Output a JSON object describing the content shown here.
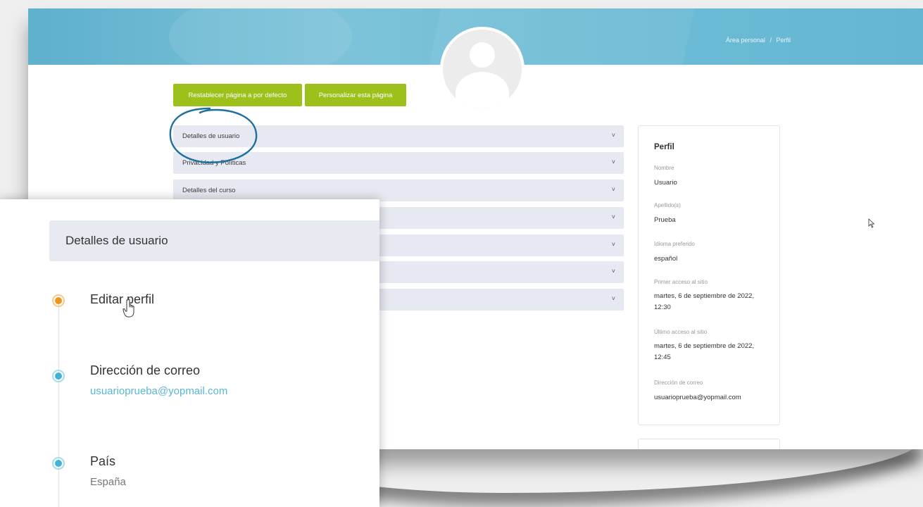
{
  "breadcrumb": {
    "item1": "Área personal",
    "separator": "/",
    "item2": "Perfil"
  },
  "buttons": {
    "reset": "Restablecer página a por defecto",
    "customize": "Personalizar esta página"
  },
  "accordion": [
    {
      "label": "Detalles de usuario"
    },
    {
      "label": "Privacidad y Políticas"
    },
    {
      "label": "Detalles del curso"
    },
    {
      "label": ""
    },
    {
      "label": ""
    },
    {
      "label": ""
    },
    {
      "label": ""
    }
  ],
  "chevron": "˅",
  "profile_card": {
    "title": "Perfil",
    "fields": [
      {
        "label": "Nombre",
        "value": "Usuario"
      },
      {
        "label": "Apellido(s)",
        "value": "Prueba"
      },
      {
        "label": "Idioma preferido",
        "value": "español"
      },
      {
        "label": "Primer acceso al sitio",
        "value": "martes, 6 de septiembre de 2022, 12:30"
      },
      {
        "label": "Último acceso al sitio",
        "value": "martes, 6 de septiembre de 2022, 12:45"
      },
      {
        "label": "Dirección de correo",
        "value": "usuarioprueba@yopmail.com"
      }
    ]
  },
  "zoom_panel": {
    "header": "Detalles de usuario",
    "items": [
      {
        "title": "Editar perfil",
        "subtitle": ""
      },
      {
        "title": "Dirección de correo",
        "subtitle": "usuarioprueba@yopmail.com"
      },
      {
        "title": "País",
        "subtitle": "España"
      }
    ]
  },
  "colors": {
    "banner": "#6fbdd6",
    "button_green": "#9dc01b",
    "accordion_bg": "#e7e9f2",
    "dot_orange": "#f2941b",
    "dot_blue": "#3fb4d4",
    "link_blue": "#5ab6d6",
    "circle_mark": "#1f6f9e"
  },
  "icons": [
    "avatar-icon",
    "chevron-down-icon",
    "pointer-cursor-icon",
    "hand-cursor-icon"
  ]
}
